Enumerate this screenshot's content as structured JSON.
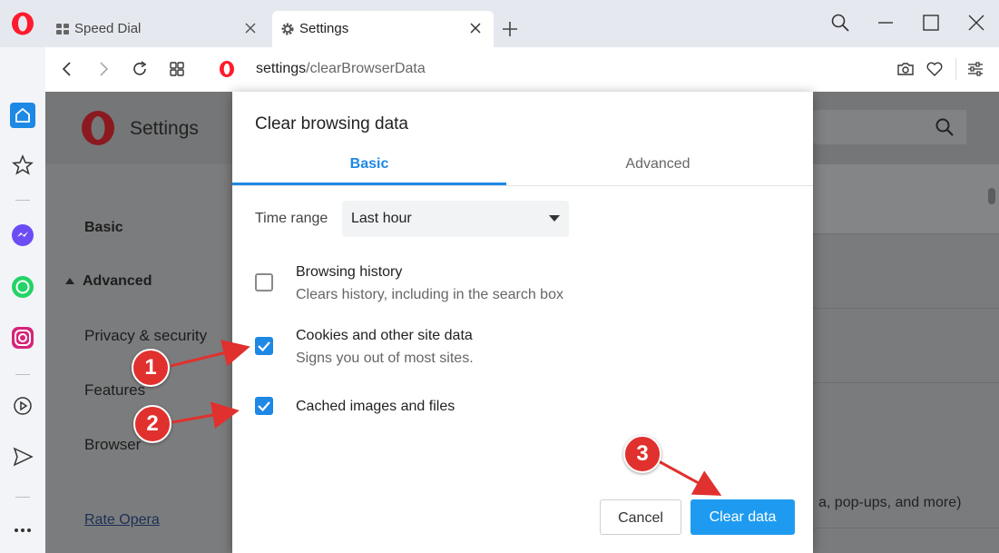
{
  "tabs": [
    {
      "label": "Speed Dial",
      "icon": "speed-dial-icon"
    },
    {
      "label": "Settings",
      "icon": "gear-icon"
    }
  ],
  "address": {
    "host": "settings",
    "path": "/clearBrowserData"
  },
  "settings_page": {
    "title": "Settings",
    "nav": {
      "basic": "Basic",
      "advanced": "Advanced",
      "privacy": "Privacy & security",
      "features": "Features",
      "browser": "Browser",
      "rate": "Rate Opera"
    },
    "partial_text": "a, pop-ups, and more)"
  },
  "dialog": {
    "title": "Clear browsing data",
    "tabs": {
      "basic": "Basic",
      "advanced": "Advanced"
    },
    "time_range": {
      "label": "Time range",
      "value": "Last hour"
    },
    "items": [
      {
        "title": "Browsing history",
        "subtitle": "Clears history, including in the search box",
        "checked": false
      },
      {
        "title": "Cookies and other site data",
        "subtitle": "Signs you out of most sites.",
        "checked": true
      },
      {
        "title": "Cached images and files",
        "subtitle": "",
        "checked": true
      }
    ],
    "buttons": {
      "cancel": "Cancel",
      "clear": "Clear data"
    }
  },
  "annotations": {
    "one": "1",
    "two": "2",
    "three": "3"
  },
  "colors": {
    "accent": "#1e88e5",
    "button": "#1e9bf0",
    "annotation": "#e0312e",
    "opera_red": "#ff1b2d"
  }
}
